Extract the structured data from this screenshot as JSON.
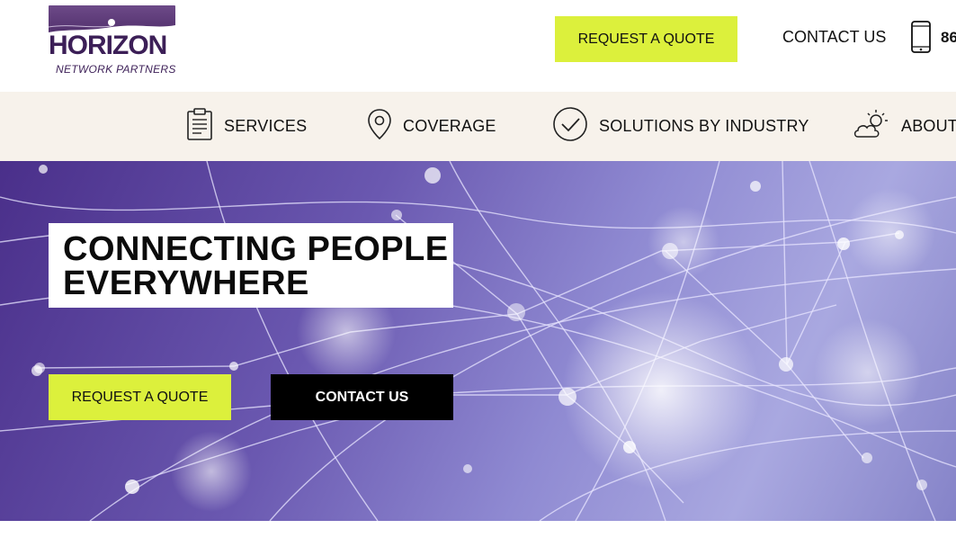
{
  "brand": {
    "name": "HORIZON",
    "tagline": "NETWORK PARTNERS",
    "accent_color": "#dcf03c",
    "logo_color": "#3c1f57"
  },
  "header": {
    "quote_button": "REQUEST A QUOTE",
    "contact_link": "CONTACT US",
    "phone_icon": "mobile-phone-icon",
    "phone_number": "86"
  },
  "nav": {
    "items": [
      {
        "label": "SERVICES",
        "icon": "clipboard-icon"
      },
      {
        "label": "COVERAGE",
        "icon": "map-pin-icon"
      },
      {
        "label": "SOLUTIONS BY INDUSTRY",
        "icon": "check-circle-icon"
      },
      {
        "label": "ABOUT",
        "icon": "partly-cloudy-icon"
      }
    ]
  },
  "hero": {
    "headline_line1": "CONNECTING PEOPLE",
    "headline_line2": "EVERYWHERE",
    "quote_button": "REQUEST A QUOTE",
    "contact_button": "CONTACT US"
  }
}
